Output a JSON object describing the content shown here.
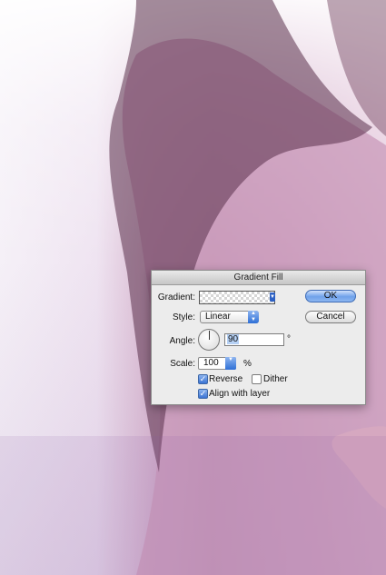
{
  "dialog": {
    "title": "Gradient Fill",
    "gradient": {
      "label": "Gradient:"
    },
    "style": {
      "label": "Style:",
      "value": "Linear"
    },
    "angle": {
      "label": "Angle:",
      "value": "90",
      "unit": "°"
    },
    "scale": {
      "label": "Scale:",
      "value": "100",
      "unit": "%"
    },
    "reverse": {
      "label": "Reverse",
      "checked": true
    },
    "dither": {
      "label": "Dither",
      "checked": false
    },
    "align": {
      "label": "Align with layer",
      "checked": true
    },
    "ok_label": "OK",
    "cancel_label": "Cancel"
  },
  "colors": {
    "dialog_bg": "#ececec",
    "accent_blue": "#3a73d4",
    "background_tint": "#d8b7cf"
  },
  "icons": {
    "angle_dial": "angle-dial-icon",
    "dropdown": "chevron-updown-icon",
    "checkmark": "checkmark-icon"
  }
}
